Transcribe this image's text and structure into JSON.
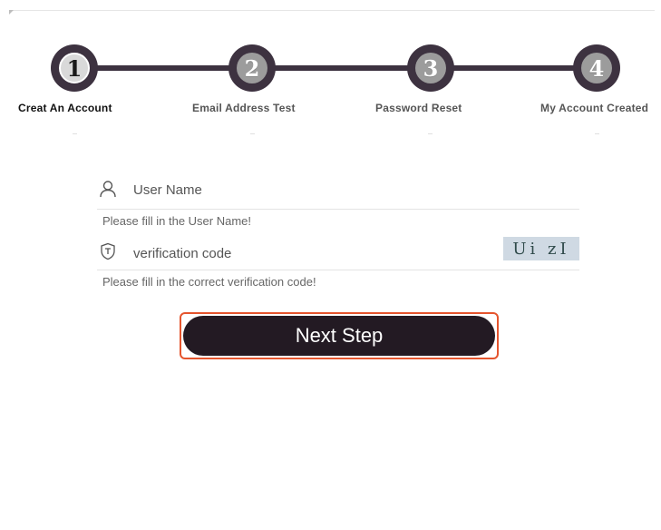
{
  "steps": [
    {
      "number": "1",
      "label": "Creat An Account",
      "active": true
    },
    {
      "number": "2",
      "label": "Email Address Test",
      "active": false
    },
    {
      "number": "3",
      "label": "Password Reset",
      "active": false
    },
    {
      "number": "4",
      "label": "My Account Created",
      "active": false
    }
  ],
  "form": {
    "username": {
      "placeholder": "User Name",
      "value": "",
      "icon": "user-icon",
      "hint": "Please fill in the User Name!"
    },
    "verification": {
      "placeholder": "verification code",
      "value": "",
      "icon": "shield-icon",
      "captcha_text": "Ui zI",
      "hint": "Please fill in the correct verification code!"
    },
    "submit_label": "Next Step"
  },
  "colors": {
    "step_dark": "#3d3240",
    "button_bg": "#231a23",
    "button_focus_border": "#e5552e"
  }
}
